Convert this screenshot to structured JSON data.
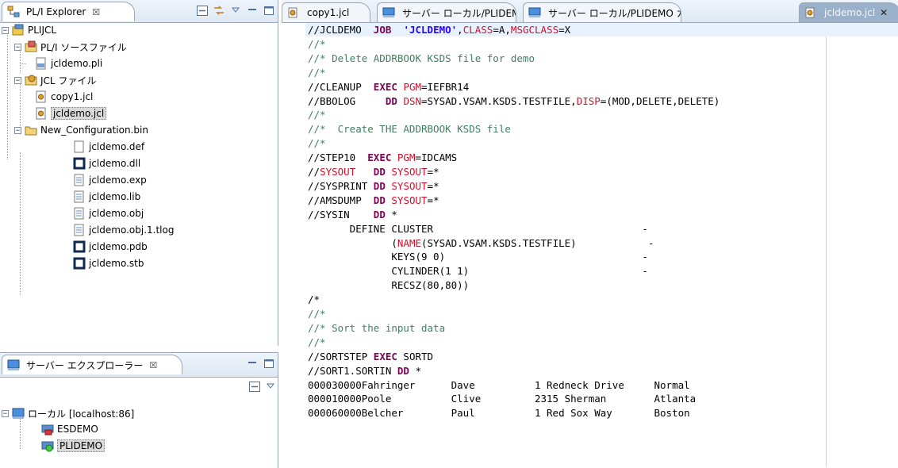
{
  "explorer": {
    "tab_label": "PL/I Explorer",
    "close_glyph": "☒",
    "tree": [
      {
        "label": "PLIJCL",
        "icon": "project-icon"
      },
      {
        "label": "PL/I ソースファイル",
        "icon": "pli-folder-icon"
      },
      {
        "label": "jcldemo.pli",
        "icon": "pli-file-icon"
      },
      {
        "label": "JCL ファイル",
        "icon": "jcl-folder-icon"
      },
      {
        "label": "copy1.jcl",
        "icon": "jcl-file-icon"
      },
      {
        "label": "jcldemo.jcl",
        "icon": "jcl-file-icon"
      },
      {
        "label": "New_Configuration.bin",
        "icon": "folder-icon"
      },
      {
        "label": "jcldemo.def",
        "icon": "file-icon"
      },
      {
        "label": "jcldemo.dll",
        "icon": "binary-file-icon"
      },
      {
        "label": "jcldemo.exp",
        "icon": "text-file-icon"
      },
      {
        "label": "jcldemo.lib",
        "icon": "text-file-icon"
      },
      {
        "label": "jcldemo.obj",
        "icon": "text-file-icon"
      },
      {
        "label": "jcldemo.obj.1.tlog",
        "icon": "text-file-icon"
      },
      {
        "label": "jcldemo.pdb",
        "icon": "binary-file-icon"
      },
      {
        "label": "jcldemo.stb",
        "icon": "binary-file-icon"
      }
    ]
  },
  "server": {
    "tab_label": "サーバー エクスプローラー",
    "close_glyph": "☒",
    "tree": [
      {
        "label": "ローカル [localhost:86]"
      },
      {
        "label": "ESDEMO"
      },
      {
        "label": "PLIDEMO"
      }
    ]
  },
  "editor": {
    "tabs": [
      {
        "label": "copy1.jcl"
      },
      {
        "label": "サーバー ローカル/PLIDEMO Jo"
      },
      {
        "label": "サーバー ローカル/PLIDEMO カタ"
      },
      {
        "label": "jcldemo.jcl"
      }
    ],
    "close_glyph": "✕",
    "lines": [
      [
        {
          "t": "//JCLDEMO  ",
          "c": "c-normal"
        },
        {
          "t": "JOB",
          "c": "c-kw"
        },
        {
          "t": "  ",
          "c": "c-normal"
        },
        {
          "t": "'JCLDEMO'",
          "c": "c-str"
        },
        {
          "t": ",",
          "c": "c-normal"
        },
        {
          "t": "CLASS",
          "c": "c-red"
        },
        {
          "t": "=A,",
          "c": "c-normal"
        },
        {
          "t": "MSGCLASS",
          "c": "c-red"
        },
        {
          "t": "=X",
          "c": "c-normal"
        }
      ],
      [
        {
          "t": "//*",
          "c": "c-comment"
        }
      ],
      [
        {
          "t": "//* Delete ADDRBOOK KSDS file for demo",
          "c": "c-comment"
        }
      ],
      [
        {
          "t": "//*",
          "c": "c-comment"
        }
      ],
      [
        {
          "t": "//CLEANUP  ",
          "c": "c-normal"
        },
        {
          "t": "EXEC",
          "c": "c-kw"
        },
        {
          "t": " ",
          "c": "c-normal"
        },
        {
          "t": "PGM",
          "c": "c-red"
        },
        {
          "t": "=IEFBR14",
          "c": "c-normal"
        }
      ],
      [
        {
          "t": "//BBOLOG     ",
          "c": "c-normal"
        },
        {
          "t": "DD",
          "c": "c-kw"
        },
        {
          "t": " ",
          "c": "c-normal"
        },
        {
          "t": "DSN",
          "c": "c-red"
        },
        {
          "t": "=SYSAD.VSAM.KSDS.TESTFILE,",
          "c": "c-normal"
        },
        {
          "t": "DISP",
          "c": "c-red"
        },
        {
          "t": "=(MOD,DELETE,DELETE)",
          "c": "c-normal"
        }
      ],
      [
        {
          "t": "//*",
          "c": "c-comment"
        }
      ],
      [
        {
          "t": "//*  Create THE ADDRBOOK KSDS file",
          "c": "c-comment"
        }
      ],
      [
        {
          "t": "//*",
          "c": "c-comment"
        }
      ],
      [
        {
          "t": "//STEP10  ",
          "c": "c-normal"
        },
        {
          "t": "EXEC",
          "c": "c-kw"
        },
        {
          "t": " ",
          "c": "c-normal"
        },
        {
          "t": "PGM",
          "c": "c-red"
        },
        {
          "t": "=IDCAMS",
          "c": "c-normal"
        }
      ],
      [
        {
          "t": "//",
          "c": "c-normal"
        },
        {
          "t": "SYSOUT",
          "c": "c-red"
        },
        {
          "t": "   ",
          "c": "c-normal"
        },
        {
          "t": "DD",
          "c": "c-kw"
        },
        {
          "t": " ",
          "c": "c-normal"
        },
        {
          "t": "SYSOUT",
          "c": "c-red"
        },
        {
          "t": "=*",
          "c": "c-normal"
        }
      ],
      [
        {
          "t": "//SYSPRINT ",
          "c": "c-normal"
        },
        {
          "t": "DD",
          "c": "c-kw"
        },
        {
          "t": " ",
          "c": "c-normal"
        },
        {
          "t": "SYSOUT",
          "c": "c-red"
        },
        {
          "t": "=*",
          "c": "c-normal"
        }
      ],
      [
        {
          "t": "//AMSDUMP  ",
          "c": "c-normal"
        },
        {
          "t": "DD",
          "c": "c-kw"
        },
        {
          "t": " ",
          "c": "c-normal"
        },
        {
          "t": "SYSOUT",
          "c": "c-red"
        },
        {
          "t": "=*",
          "c": "c-normal"
        }
      ],
      [
        {
          "t": "//SYSIN    ",
          "c": "c-normal"
        },
        {
          "t": "DD",
          "c": "c-kw"
        },
        {
          "t": " *",
          "c": "c-normal"
        }
      ],
      [
        {
          "t": "       DEFINE CLUSTER                                   -",
          "c": "c-normal"
        }
      ],
      [
        {
          "t": "              (",
          "c": "c-normal"
        },
        {
          "t": "NAME",
          "c": "c-red"
        },
        {
          "t": "(SYSAD.VSAM.KSDS.TESTFILE)            -",
          "c": "c-normal"
        }
      ],
      [
        {
          "t": "              KEYS(9 0)                                 -",
          "c": "c-normal"
        }
      ],
      [
        {
          "t": "              CYLINDER(1 1)                             -",
          "c": "c-normal"
        }
      ],
      [
        {
          "t": "              RECSZ(80,80))",
          "c": "c-normal"
        }
      ],
      [
        {
          "t": "/*",
          "c": "c-normal"
        }
      ],
      [
        {
          "t": "//*",
          "c": "c-comment"
        }
      ],
      [
        {
          "t": "//* Sort the input data",
          "c": "c-comment"
        }
      ],
      [
        {
          "t": "//*",
          "c": "c-comment"
        }
      ],
      [
        {
          "t": "//SORTSTEP ",
          "c": "c-normal"
        },
        {
          "t": "EXEC",
          "c": "c-kw"
        },
        {
          "t": " SORTD",
          "c": "c-normal"
        }
      ],
      [
        {
          "t": "//SORT1.SORTIN ",
          "c": "c-normal"
        },
        {
          "t": "DD",
          "c": "c-kw"
        },
        {
          "t": " *",
          "c": "c-normal"
        }
      ],
      [
        {
          "t": "000030000Fahringer      Dave          1 Redneck Drive     Normal",
          "c": "c-normal"
        }
      ],
      [
        {
          "t": "000010000Poole          Clive         2315 Sherman        Atlanta",
          "c": "c-normal"
        }
      ],
      [
        {
          "t": "000060000Belcher        Paul          1 Red Sox Way       Boston",
          "c": "c-normal"
        }
      ]
    ]
  }
}
